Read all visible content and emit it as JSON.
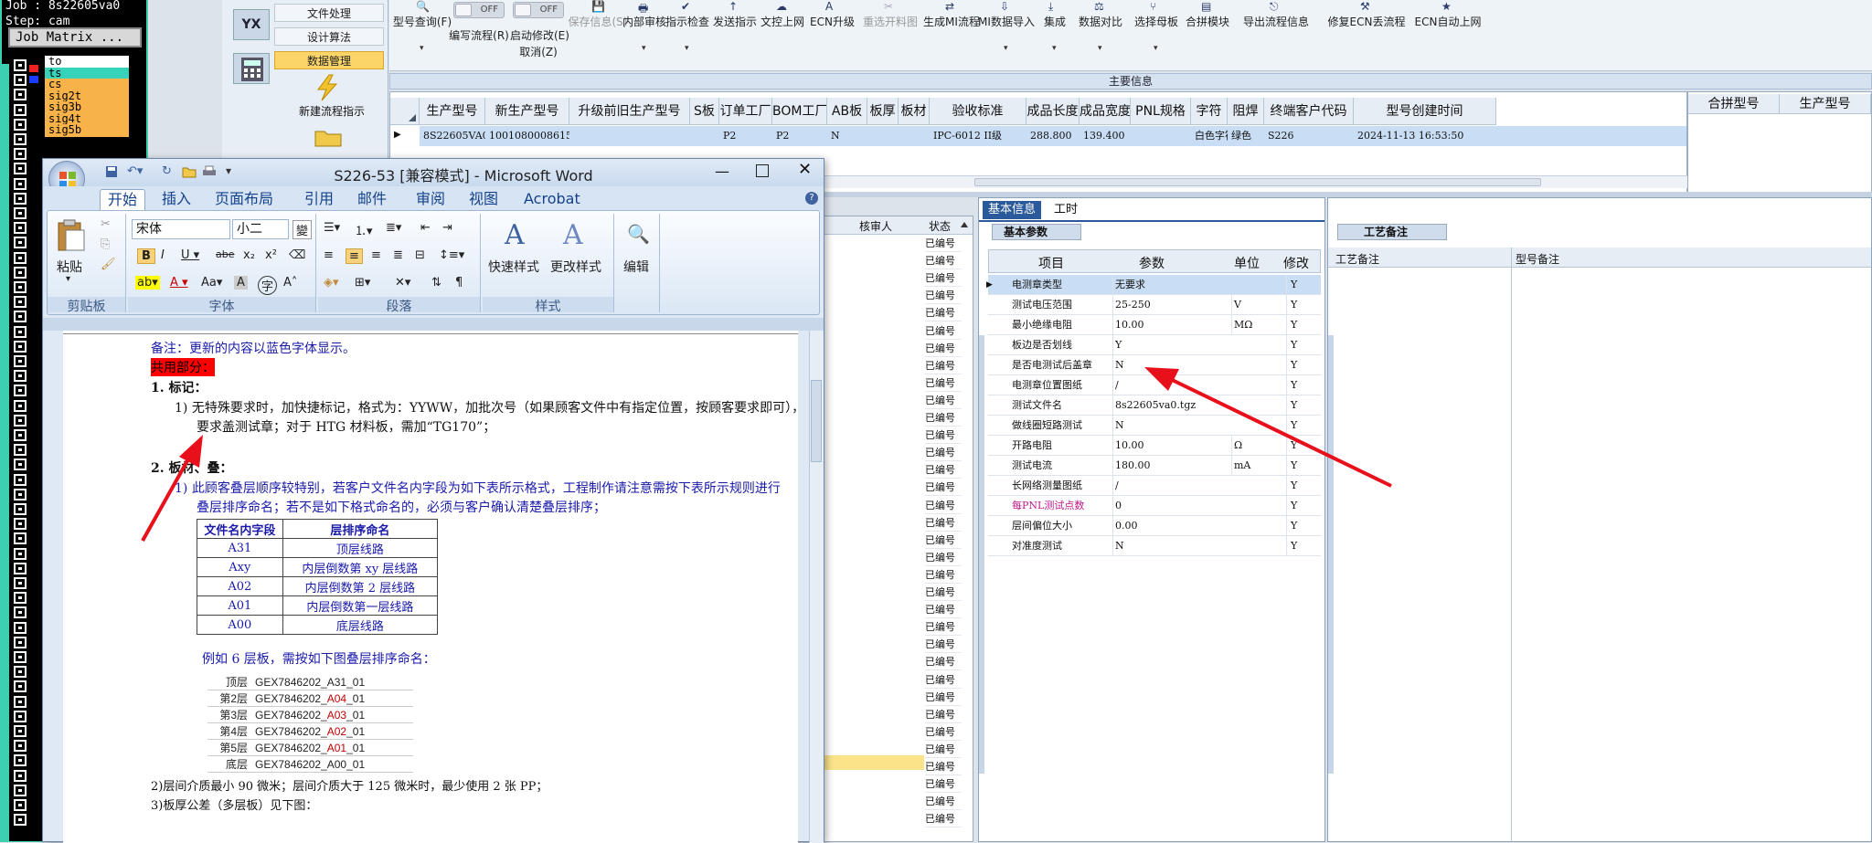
{
  "cam": {
    "job": "Job : 8s22605va0",
    "step": "Step: cam",
    "matrix_button": "Job Matrix ...",
    "layers": [
      {
        "name": "to",
        "color": "#ffffff"
      },
      {
        "name": "ts",
        "color": "#37d2ba"
      },
      {
        "name": "cs",
        "color": "#f8b24a"
      },
      {
        "name": "sig2t",
        "color": "#f8b24a"
      },
      {
        "name": "sig3b",
        "color": "#f8b24a"
      },
      {
        "name": "sig4t",
        "color": "#f8b24a"
      },
      {
        "name": "sig5b",
        "color": "#f8b24a"
      }
    ]
  },
  "nav": {
    "logo": "YX",
    "items": [
      "文件处理",
      "设计算法",
      "数据管理"
    ],
    "new_flow": "新建流程指示",
    "open_label": "打开"
  },
  "toolbar": {
    "buttons": [
      {
        "label": "型号查询(F)",
        "icon": "search-icon",
        "dropdown": true
      },
      {
        "label": "编写流程(R)",
        "icon": "toggle-off",
        "toggle": "OFF"
      },
      {
        "label": "启动修改(E)",
        "icon": "toggle-off",
        "toggle": "OFF",
        "sub": "取消(Z)"
      },
      {
        "label": "保存信息(S)",
        "icon": "save-icon",
        "disabled": true
      },
      {
        "label": "内部审核",
        "icon": "print-icon",
        "dropdown": true
      },
      {
        "label": "指示检查",
        "icon": "check-icon",
        "dropdown": true
      },
      {
        "label": "发送指示",
        "icon": "send-icon"
      },
      {
        "label": "文控上网",
        "icon": "cloud-icon"
      },
      {
        "label": "ECN升级",
        "icon": "font-icon"
      },
      {
        "label": "重选开料图",
        "icon": "cut-icon",
        "disabled": true
      },
      {
        "label": "生成MI流程",
        "icon": "flow-icon"
      },
      {
        "label": "MI数据导入",
        "icon": "import-icon",
        "dropdown": true
      },
      {
        "label": "集成",
        "icon": "download-icon",
        "dropdown": true
      },
      {
        "label": "数据对比",
        "icon": "compare-icon",
        "dropdown": true
      },
      {
        "label": "选择母板",
        "icon": "branch-icon",
        "dropdown": true
      },
      {
        "label": "合拼模块",
        "icon": "merge-icon"
      },
      {
        "label": "导出流程信息",
        "icon": "export-icon"
      },
      {
        "label": "修复ECN丢流程",
        "icon": "repair-icon"
      },
      {
        "label": "ECN自动上网",
        "icon": "star-icon"
      }
    ]
  },
  "main_info": {
    "title": "主要信息",
    "headers": [
      "生产型号",
      "新生产型号",
      "升级前旧生产型号",
      "S板",
      "订单工厂",
      "BOM工厂",
      "AB板",
      "板厚",
      "板材",
      "验收标准",
      "成品长度",
      "成品宽度",
      "PNL规格",
      "字符",
      "阻焊",
      "终端客户代码",
      "型号创建时间"
    ],
    "row": [
      "8S22605VA0",
      "10010800086157",
      "",
      "",
      "P2",
      "P2",
      "N",
      "",
      "",
      "IPC-6012 II级",
      "288.800",
      "139.400",
      "",
      "白色字符",
      "绿色",
      "S226",
      "2024-11-13 16:53:50"
    ],
    "side_headers": [
      "合拼型号",
      "生产型号"
    ]
  },
  "mid_list": {
    "headers": [
      "核审人",
      "状态"
    ],
    "status": [
      "已编号",
      "已编号",
      "已编号",
      "已编号",
      "已编号",
      "已编号",
      "已编号",
      "已编号",
      "已编号",
      "已编号",
      "已编号",
      "已编号",
      "已编号",
      "已编号",
      "已编号",
      "已编号",
      "已编号",
      "已编号",
      "已编号",
      "已编号",
      "已编号",
      "已编号",
      "已编号",
      "已编号",
      "已编号",
      "已编号",
      "已编号",
      "已编号",
      "已编号",
      "已编号",
      "已编号",
      "已编号",
      "已编号",
      "已编号"
    ]
  },
  "basic_info": {
    "tabs": [
      "基本信息",
      "工时"
    ],
    "subtab": "基本参数",
    "headers": [
      "项目",
      "参数",
      "单位",
      "修改"
    ],
    "rows": [
      {
        "item": "电测章类型",
        "param": "无要求",
        "unit": "",
        "mod": "Y",
        "highlight": true
      },
      {
        "item": "测试电压范围",
        "param": "25-250",
        "unit": "V",
        "mod": "Y"
      },
      {
        "item": "最小绝缘电阻",
        "param": "10.00",
        "unit": "MΩ",
        "mod": "Y"
      },
      {
        "item": "板边是否划线",
        "param": "Y",
        "unit": "",
        "mod": "Y"
      },
      {
        "item": "是否电测试后盖章",
        "param": "N",
        "unit": "",
        "mod": "Y"
      },
      {
        "item": "电测章位置图纸",
        "param": "/",
        "unit": "",
        "mod": "Y"
      },
      {
        "item": "测试文件名",
        "param": "8s22605va0.tgz",
        "unit": "",
        "mod": "Y"
      },
      {
        "item": "做线圈短路测试",
        "param": "N",
        "unit": "",
        "mod": "Y"
      },
      {
        "item": "开路电阻",
        "param": "10.00",
        "unit": "Ω",
        "mod": "Y"
      },
      {
        "item": "测试电流",
        "param": "180.00",
        "unit": "mA",
        "mod": "Y"
      },
      {
        "item": "长网络测量图纸",
        "param": "/",
        "unit": "",
        "mod": "Y"
      },
      {
        "item": "每PNL测试点数",
        "param": "0",
        "unit": "",
        "mod": "Y",
        "red": true
      },
      {
        "item": "层间偏位大小",
        "param": "0.00",
        "unit": "",
        "mod": "Y"
      },
      {
        "item": "对准度测试",
        "param": "N",
        "unit": "",
        "mod": "Y"
      }
    ]
  },
  "remarks": {
    "tab": "工艺备注",
    "cols": [
      "工艺备注",
      "型号备注"
    ]
  },
  "word": {
    "title": "S226-53 [兼容模式] - Microsoft Word",
    "tabs": [
      "开始",
      "插入",
      "页面布局",
      "引用",
      "邮件",
      "审阅",
      "视图",
      "Acrobat"
    ],
    "font": "宋体",
    "size": "小二",
    "groups": [
      "剪贴板",
      "字体",
      "段落",
      "样式",
      "编辑"
    ],
    "paste": "粘贴",
    "quick_style": "快速样式",
    "change_style": "更改样式",
    "edit": "编辑",
    "doc": {
      "note": "备注：更新的内容以蓝色字体显示。",
      "common": "共用部分：",
      "h1": "1.   标记：",
      "p1a": "1)  无特殊要求时，加快捷标记，格式为：YYWW，加批次号（如果顾客文件中有指定位置，按顾客要求即可），",
      "p1b": "要求盖测试章；对于 HTG 材料板，需加“TG170”；",
      "h2": "2.   板材、叠：",
      "p2a": "1)  此顾客叠层顺序较特别，若客户文件名内字段为如下表所示格式，工程制作请注意需按下表所示规则进行",
      "p2b": "叠层排序命名；若不是如下格式命名的，必须与客户确认清楚叠层排序；",
      "table1_head": [
        "文件名内字段",
        "层排序命名"
      ],
      "table1": [
        [
          "A31",
          "顶层线路"
        ],
        [
          "Axy",
          "内层倒数第 xy 层线路"
        ],
        [
          "A02",
          "内层倒数第 2 层线路"
        ],
        [
          "A01",
          "内层倒数第一层线路"
        ],
        [
          "A00",
          "底层线路"
        ]
      ],
      "example": "例如 6 层板，需按如下图叠层排序命名：",
      "table2": [
        {
          "layer": "顶层",
          "prefix": "GEX7846202_",
          "code": "A31",
          "suffix": "_01",
          "red": false
        },
        {
          "layer": "第2层",
          "prefix": "GEX7846202_",
          "code": "A04",
          "suffix": "_01",
          "red": true
        },
        {
          "layer": "第3层",
          "prefix": "GEX7846202_",
          "code": "A03",
          "suffix": "_01",
          "red": true
        },
        {
          "layer": "第4层",
          "prefix": "GEX7846202_",
          "code": "A02",
          "suffix": "_01",
          "red": true
        },
        {
          "layer": "第5层",
          "prefix": "GEX7846202_",
          "code": "A01",
          "suffix": "_01",
          "red": true
        },
        {
          "layer": "底层",
          "prefix": "GEX7846202_",
          "code": "A00",
          "suffix": "_01",
          "red": false
        }
      ],
      "p3": "2)层间介质最小 90 微米；层间介质大于 125 微米时，最少使用 2 张 PP；",
      "p4": "3)板厚公差（多层板）见下图："
    }
  },
  "colors": {
    "arrow": "#e8101a",
    "accent": "#fbd568",
    "link_blue": "#1a1aaa"
  }
}
